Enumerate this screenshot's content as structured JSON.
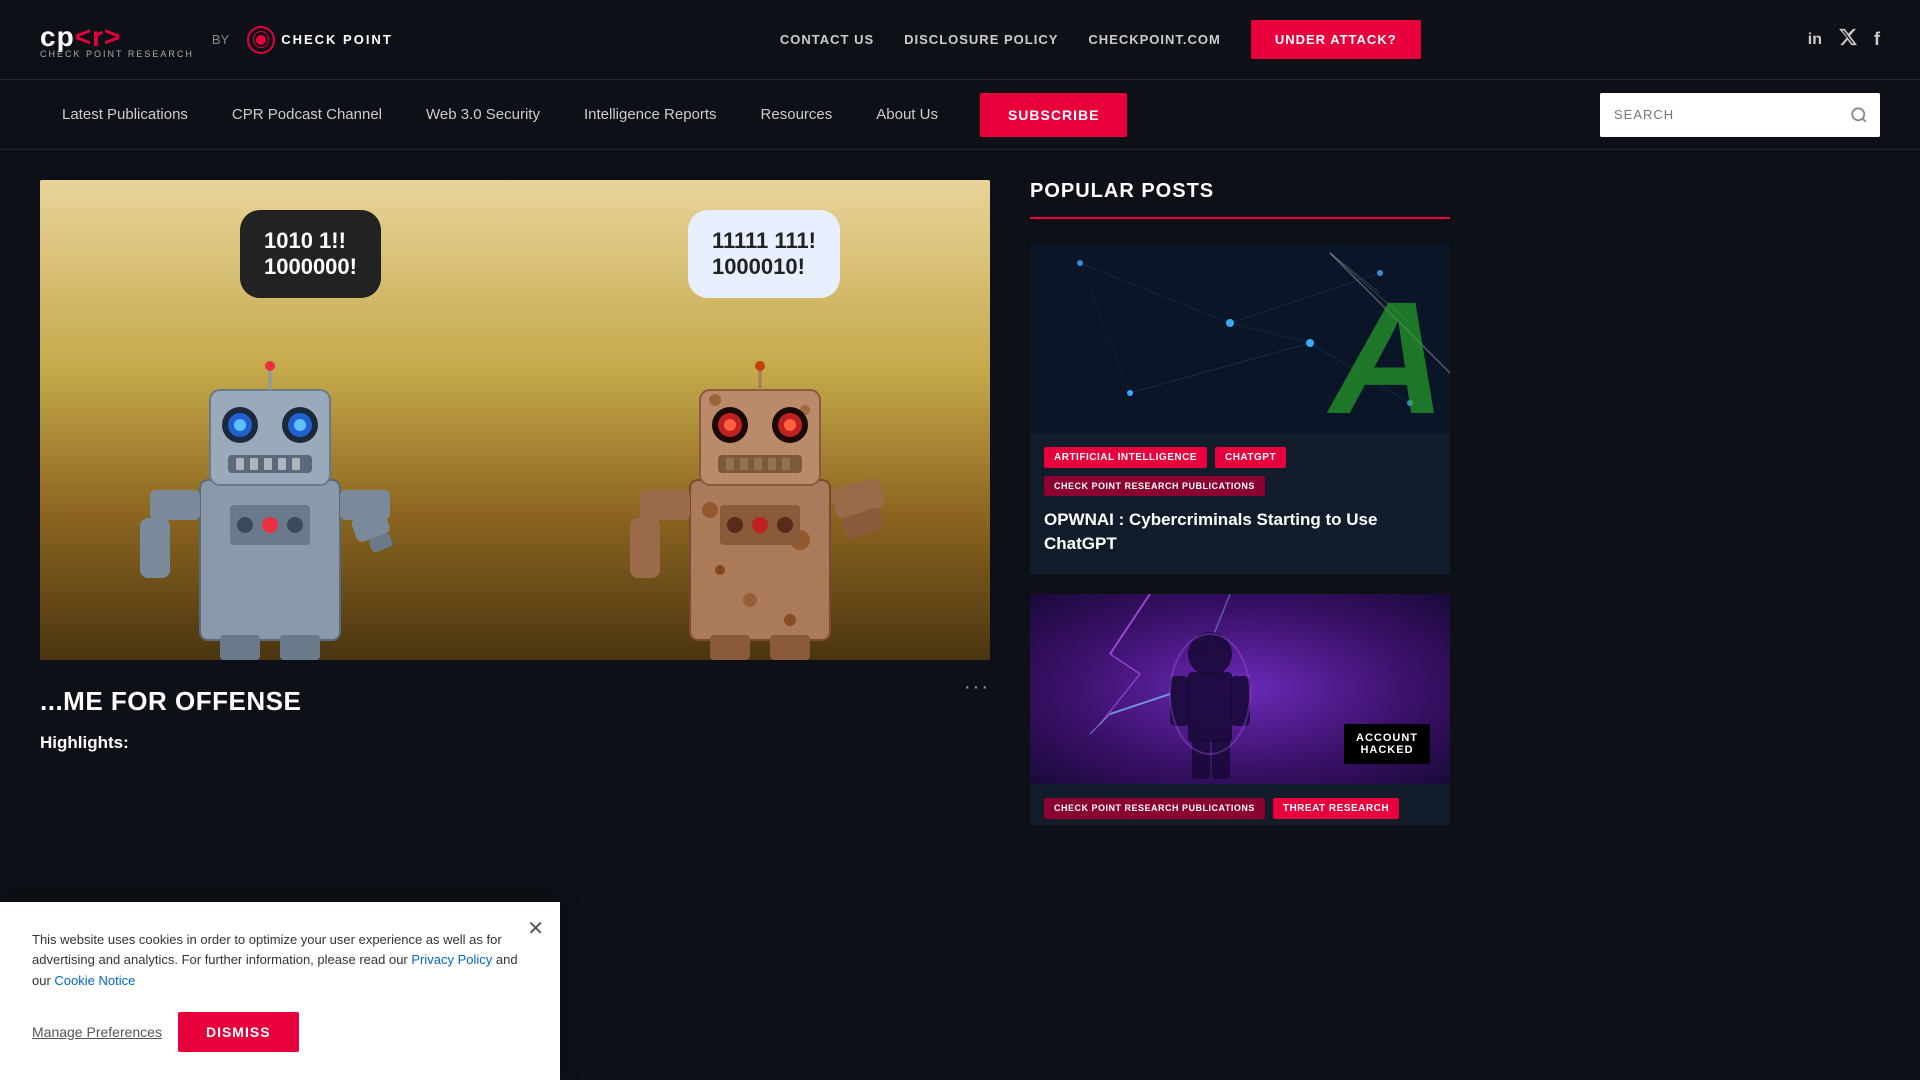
{
  "header": {
    "logo_text": "cp<r>",
    "logo_sub": "CHECK POINT RESEARCH",
    "by_text": "BY",
    "checkpoint_name": "CHECK POINT",
    "nav": {
      "contact": "CONTACT US",
      "disclosure": "DISCLOSURE POLICY",
      "checkpoint_com": "CHECKPOINT.COM",
      "under_attack": "UNDER ATTACK?"
    },
    "social": {
      "linkedin": "in",
      "twitter": "t",
      "facebook": "f"
    }
  },
  "navbar": {
    "items": [
      {
        "label": "Latest Publications",
        "href": "#"
      },
      {
        "label": "CPR Podcast Channel",
        "href": "#"
      },
      {
        "label": "Web 3.0 Security",
        "href": "#"
      },
      {
        "label": "Intelligence Reports",
        "href": "#"
      },
      {
        "label": "Resources",
        "href": "#"
      },
      {
        "label": "About Us",
        "href": "#"
      }
    ],
    "subscribe_label": "SUBSCRIBE",
    "search_placeholder": "SEARCH"
  },
  "hero": {
    "speech_left_line1": "1010 1!!",
    "speech_left_line2": "1000000!",
    "speech_right_line1": "11111 111!",
    "speech_right_line2": "1000010!",
    "title": "...ME FOR OFFENSE",
    "highlights": "Highlights:"
  },
  "popular_posts": {
    "section_title": "POPULAR POSTS",
    "posts": [
      {
        "tags": [
          "ARTIFICIAL INTELLIGENCE",
          "CHATGPT",
          "CHECK POINT RESEARCH PUBLICATIONS"
        ],
        "tag_colors": [
          "tag-red",
          "tag-red",
          "tag-darkest"
        ],
        "title": "OPWNAI : Cybercriminals Starting to Use ChatGPT",
        "image_type": "ai"
      },
      {
        "tags": [
          "CHECK POINT RESEARCH PUBLICATIONS",
          "THREAT RESEARCH"
        ],
        "tag_colors": [
          "tag-darkest",
          "tag-red"
        ],
        "title": "",
        "image_type": "game",
        "badge": "ACCOUNT\nHACKED"
      }
    ]
  },
  "cookie": {
    "text": "This website uses cookies in order to optimize your user experience as well as for advertising and analytics.  For further information, please read our ",
    "privacy_link": "Privacy Policy",
    "and_text": " and our ",
    "notice_link": "Cookie Notice",
    "manage_label": "Manage Preferences",
    "dismiss_label": "DISMISS"
  }
}
